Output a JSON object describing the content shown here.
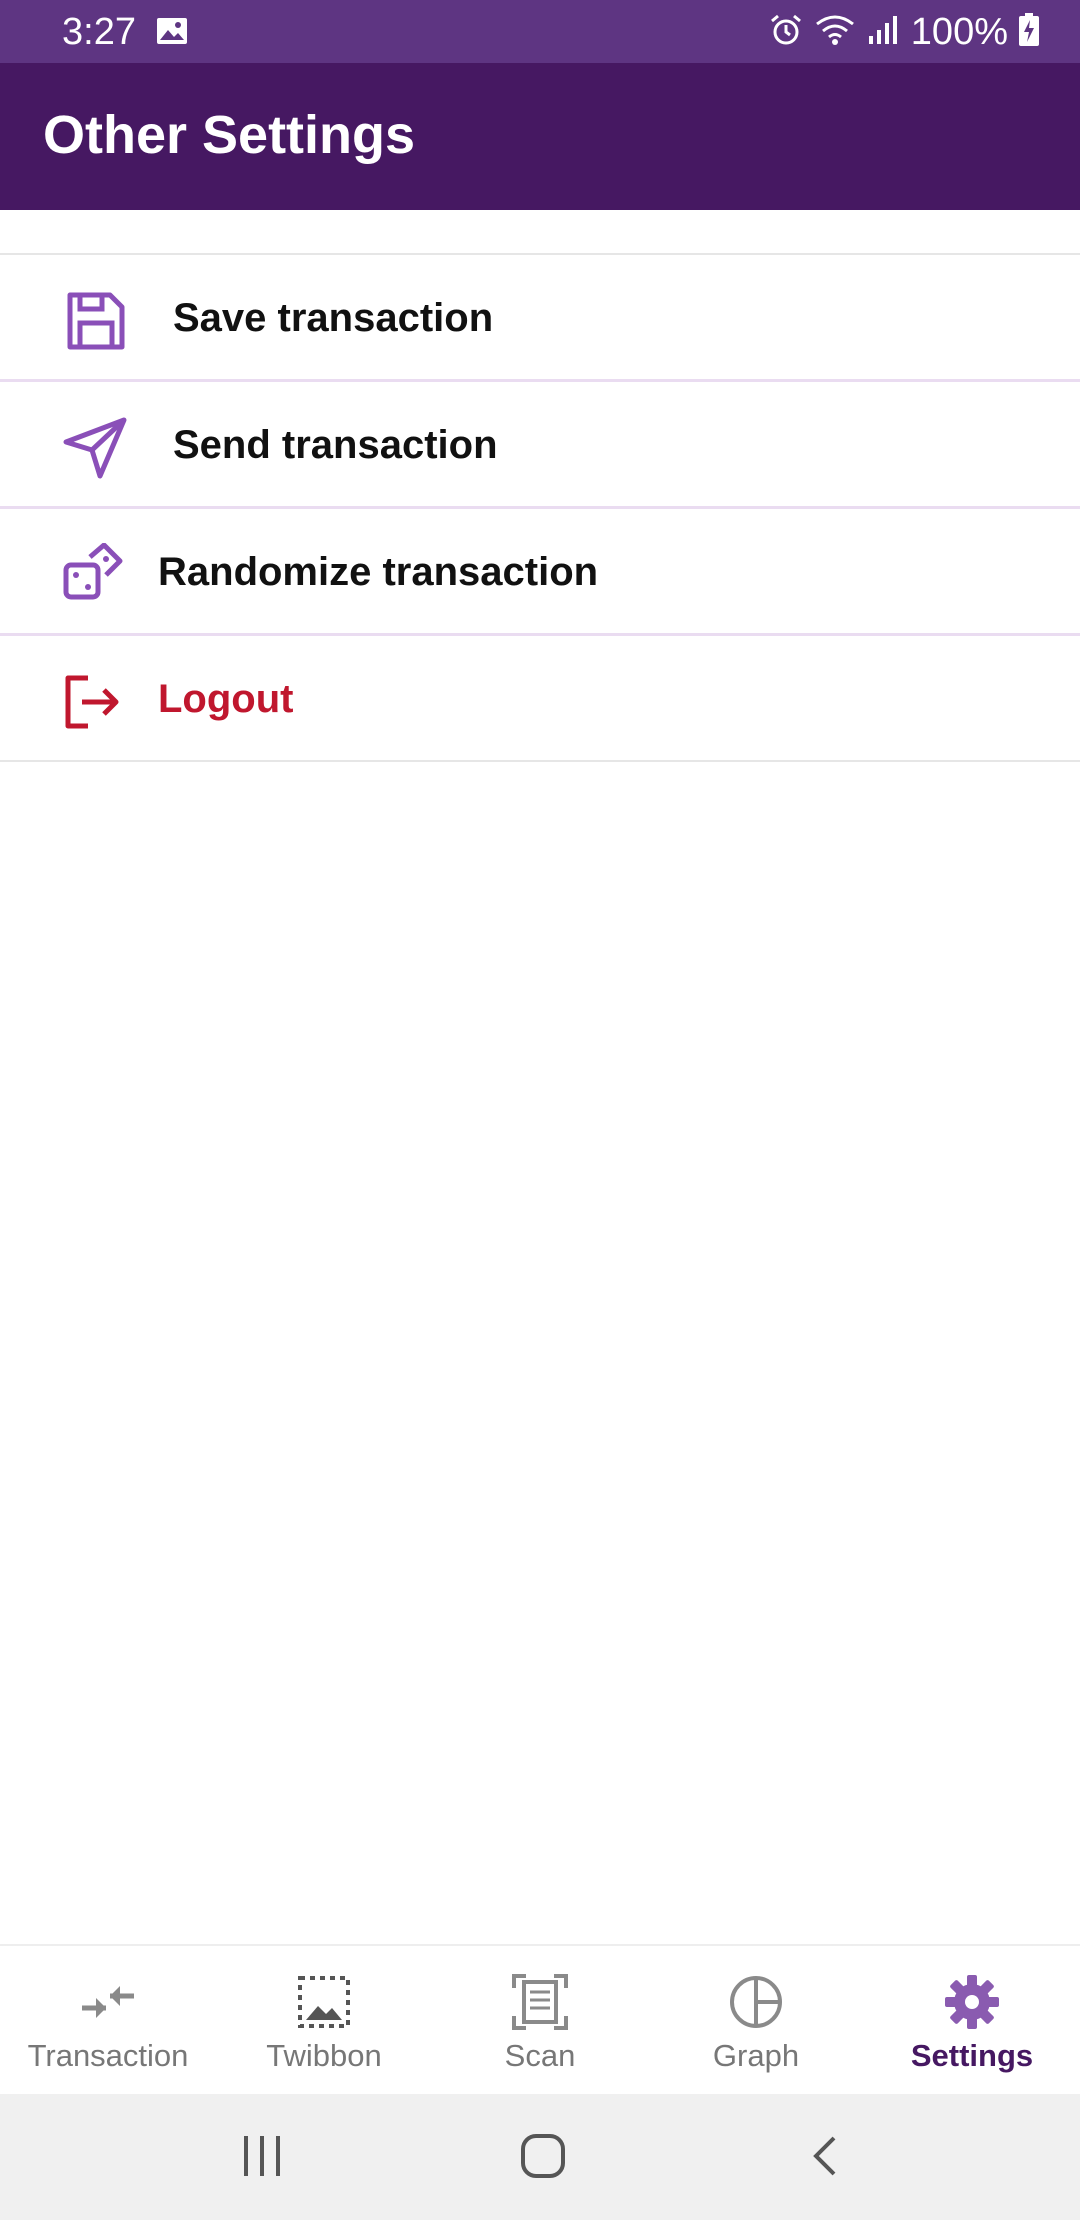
{
  "status_bar": {
    "time": "3:27",
    "battery": "100%",
    "icons": [
      "image-icon",
      "alarm-icon",
      "wifi-icon",
      "signal-icon",
      "battery-charging-icon"
    ]
  },
  "app_bar": {
    "title": "Other Settings"
  },
  "menu": {
    "items": [
      {
        "label": "Save transaction",
        "icon": "save-icon"
      },
      {
        "label": "Send transaction",
        "icon": "send-icon"
      },
      {
        "label": "Randomize transaction",
        "icon": "dice-icon"
      },
      {
        "label": "Logout",
        "icon": "logout-icon"
      }
    ]
  },
  "bottom_nav": {
    "items": [
      {
        "label": "Transaction",
        "icon": "transfer-icon"
      },
      {
        "label": "Twibbon",
        "icon": "image-frame-icon"
      },
      {
        "label": "Scan",
        "icon": "scan-icon"
      },
      {
        "label": "Graph",
        "icon": "pie-chart-icon"
      },
      {
        "label": "Settings",
        "icon": "gear-icon"
      }
    ],
    "active": "Settings"
  },
  "colors": {
    "status_bar": "#5e3582",
    "app_bar": "#461862",
    "accent": "#8a4fb8",
    "danger": "#c0172e",
    "nav_inactive": "#777777",
    "nav_active": "#461862"
  }
}
